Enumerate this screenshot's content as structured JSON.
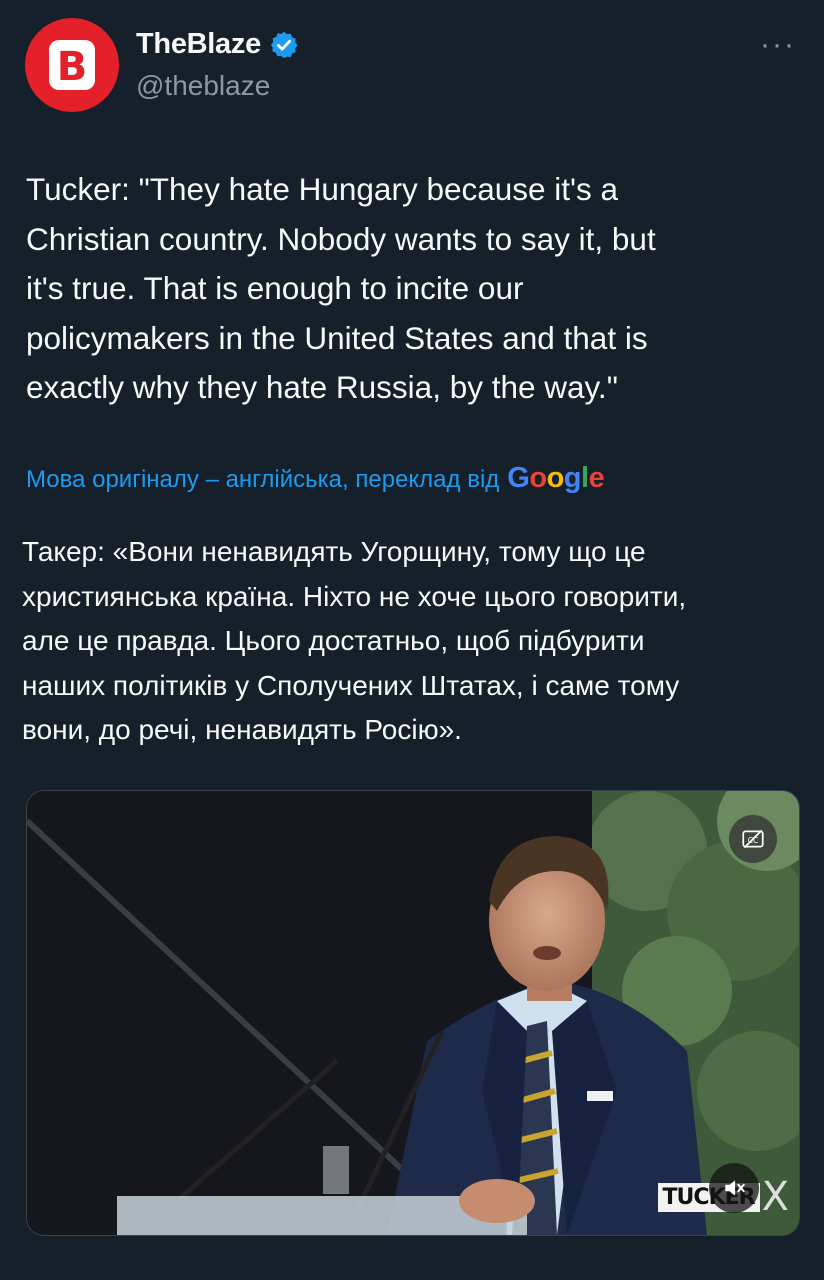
{
  "account": {
    "name": "TheBlaze",
    "handle": "@theblaze",
    "avatar_letter": "B",
    "avatar_color": "#e4202a",
    "verified_color": "#1d9bf0"
  },
  "menu": {
    "more_label": "···"
  },
  "tweet": {
    "text": "Tucker: \"They hate Hungary because it's a\nChristian country. Nobody wants to say it, but\nit's true. That is enough to incite our\npolicymakers in the United States and that is\nexactly why they hate Russia, by the way.\""
  },
  "translation": {
    "link_label": "Мова оригіналу – англійська, переклад від",
    "provider": "Google",
    "text": "Такер: «Вони ненавидять Угорщину, тому що це\nхристиянська країна. Ніхто не хоче цього говорити,\nале це правда. Цього достатньо, щоб підбурити\nнаших політиків у Сполучених Штатах, і саме тому\nвони, до речі, ненавидять Росію»."
  },
  "media": {
    "watermark_text": "TUCKER",
    "watermark_suffix": "X",
    "icons": [
      "captions-off-icon",
      "muted-speaker-icon"
    ]
  }
}
